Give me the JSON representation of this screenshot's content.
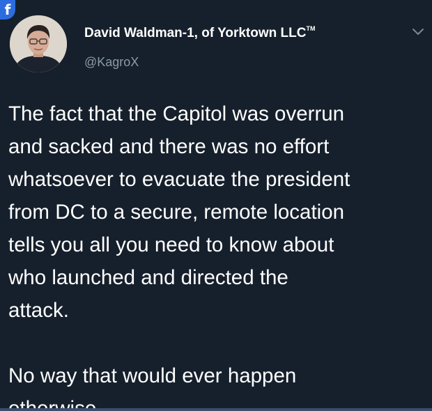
{
  "app": {
    "badge_glyph": "f",
    "badge_icon": "facebook-icon"
  },
  "author": {
    "name": "David Waldman-1, of Yorktown LLC",
    "name_mark": "TM",
    "handle": "@KagroX"
  },
  "menu": {
    "icon": "chevron-down-icon"
  },
  "tweet": {
    "text": "The fact that the Capitol was overrun\nand sacked and there was no effort\nwhatsoever to evacuate the president\nfrom DC to a secure, remote location\ntells you all you need to know about\nwho launched and directed the\nattack.\n\nNo way that would ever happen\notherwise."
  },
  "colors": {
    "background": "#16202c",
    "text": "#ffffff",
    "handle": "#8c99a8",
    "facebook_blue": "#2d6cdf"
  }
}
